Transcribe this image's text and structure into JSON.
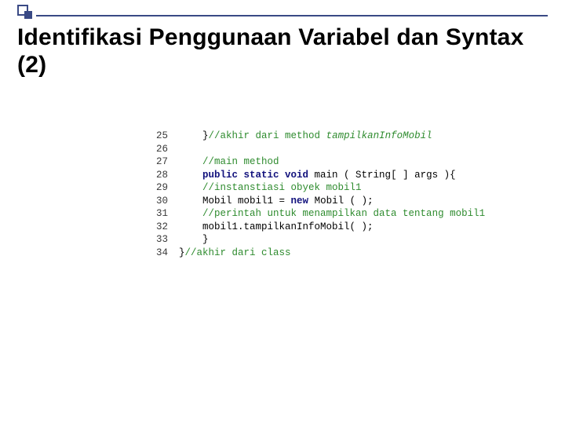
{
  "title": "Identifikasi Penggunaan Variabel dan Syntax (2)",
  "code": {
    "lines": [
      {
        "n": "25",
        "indent": "    ",
        "seg": [
          {
            "t": "}",
            "c": "c-black"
          },
          {
            "t": "//akhir dari method ",
            "c": "c-green"
          },
          {
            "t": "tampilkanInfoMobil",
            "c": "c-green-i"
          }
        ]
      },
      {
        "n": "26",
        "indent": "",
        "seg": [
          {
            "t": " ",
            "c": "c-black"
          }
        ]
      },
      {
        "n": "27",
        "indent": "    ",
        "seg": [
          {
            "t": "//main method",
            "c": "c-green"
          }
        ]
      },
      {
        "n": "28",
        "indent": "    ",
        "seg": [
          {
            "t": "public static void ",
            "c": "c-navy"
          },
          {
            "t": "main ( String[ ] args ){",
            "c": "c-black"
          }
        ]
      },
      {
        "n": "29",
        "indent": "    ",
        "seg": [
          {
            "t": "//instanstiasi obyek mobil1",
            "c": "c-green"
          }
        ]
      },
      {
        "n": "30",
        "indent": "    ",
        "seg": [
          {
            "t": "Mobil mobil1 = ",
            "c": "c-black"
          },
          {
            "t": "new",
            "c": "c-navy"
          },
          {
            "t": " Mobil ( );",
            "c": "c-black"
          }
        ]
      },
      {
        "n": "31",
        "indent": "    ",
        "seg": [
          {
            "t": "//perintah untuk menampilkan data tentang mobil1",
            "c": "c-green"
          }
        ]
      },
      {
        "n": "32",
        "indent": "    ",
        "seg": [
          {
            "t": "mobil1.tampilkanInfoMobil( );",
            "c": "c-black"
          }
        ]
      },
      {
        "n": "33",
        "indent": "    ",
        "seg": [
          {
            "t": "}",
            "c": "c-black"
          }
        ]
      },
      {
        "n": "34",
        "indent": "",
        "seg": [
          {
            "t": "}",
            "c": "c-black"
          },
          {
            "t": "//akhir dari class",
            "c": "c-green"
          }
        ]
      }
    ]
  }
}
